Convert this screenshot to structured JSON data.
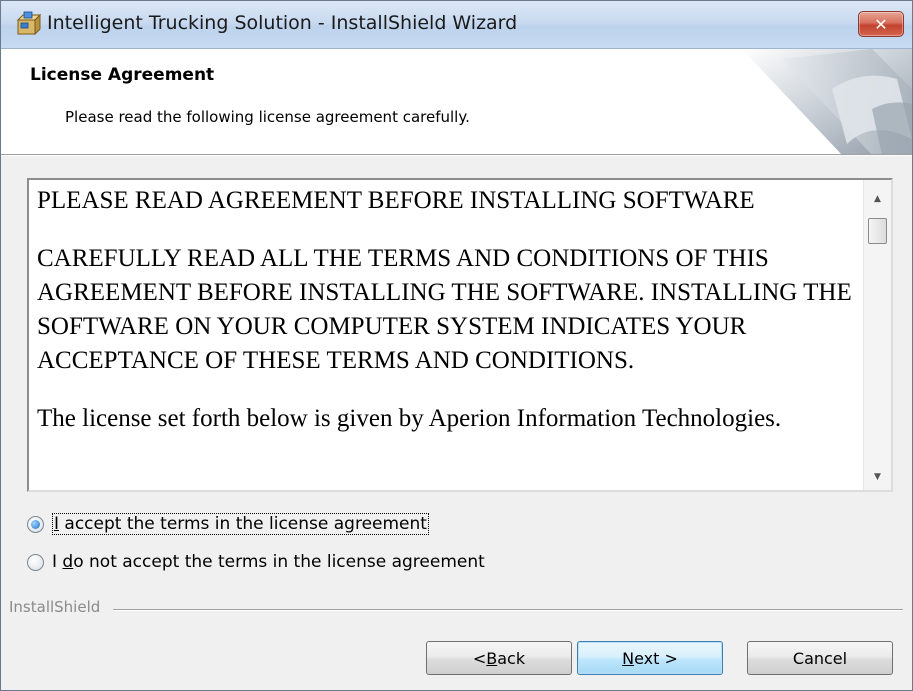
{
  "window": {
    "title": "Intelligent Trucking Solution - InstallShield Wizard",
    "close_glyph": "✕"
  },
  "header": {
    "title": "License Agreement",
    "subtitle": "Please read the following license agreement carefully."
  },
  "license": {
    "paragraphs": [
      "PLEASE READ AGREEMENT BEFORE INSTALLING SOFTWARE",
      "CAREFULLY READ ALL THE TERMS AND CONDITIONS OF THIS AGREEMENT BEFORE INSTALLING THE SOFTWARE. INSTALLING THE SOFTWARE ON YOUR COMPUTER SYSTEM INDICATES YOUR ACCEPTANCE OF THESE TERMS AND CONDITIONS.",
      "The license set forth below is given by Aperion Information Technologies."
    ]
  },
  "options": {
    "accept": {
      "label_pre": "",
      "label_key": "I",
      "label_post": " accept the terms in the license agreement",
      "selected": true
    },
    "decline": {
      "label_pre": "I ",
      "label_key": "d",
      "label_post": "o not accept the terms in the license agreement",
      "selected": false
    }
  },
  "footer": {
    "brand": "InstallShield"
  },
  "buttons": {
    "back": {
      "pre": "< ",
      "key": "B",
      "post": "ack"
    },
    "next": {
      "pre": "",
      "key": "N",
      "post": "ext >"
    },
    "cancel": "Cancel"
  },
  "colors": {
    "title_bar": "#c9daf0",
    "close_button": "#c2432e",
    "default_button_border": "#3c7fb1"
  },
  "icons": {
    "title": "installer-box-icon",
    "close": "close-icon",
    "scroll_up": "scroll-up-arrow-icon",
    "scroll_down": "scroll-down-arrow-icon"
  }
}
